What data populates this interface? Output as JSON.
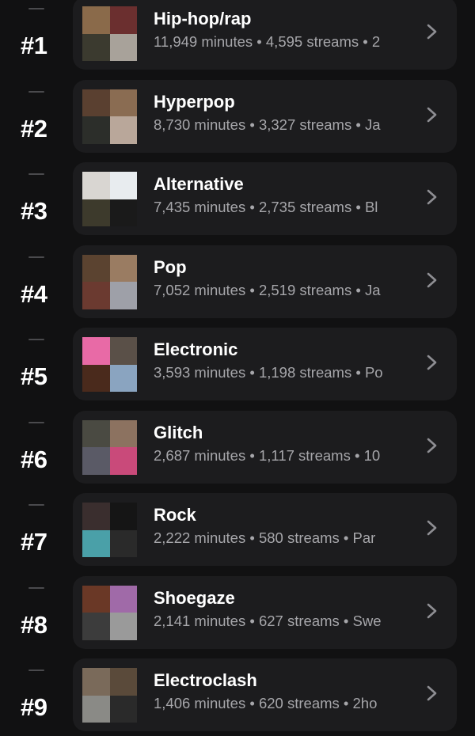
{
  "rows": [
    {
      "rank": "#1",
      "genre": "Hip-hop/rap",
      "meta": "11,949 minutes • 4,595 streams • 2",
      "art": [
        "#8a6a4a",
        "#6b2f2f",
        "#3b3a2f",
        "#a8a29a"
      ]
    },
    {
      "rank": "#2",
      "genre": "Hyperpop",
      "meta": "8,730 minutes • 3,327 streams • Ja",
      "art": [
        "#5a4030",
        "#8a6c52",
        "#2c2e2a",
        "#b9a79a"
      ]
    },
    {
      "rank": "#3",
      "genre": "Alternative",
      "meta": "7,435 minutes • 2,735 streams • Bl",
      "art": [
        "#d9d6d2",
        "#e8ecef",
        "#3d3a2c",
        "#1a1a1a"
      ]
    },
    {
      "rank": "#4",
      "genre": "Pop",
      "meta": "7,052 minutes • 2,519 streams • Ja",
      "art": [
        "#5b4330",
        "#9a7c62",
        "#6b3a30",
        "#9ea0a8"
      ]
    },
    {
      "rank": "#5",
      "genre": "Electronic",
      "meta": "3,593 minutes • 1,198 streams • Po",
      "art": [
        "#e86aa6",
        "#5a5048",
        "#4a2a1c",
        "#8aa4c0"
      ]
    },
    {
      "rank": "#6",
      "genre": "Glitch",
      "meta": "2,687 minutes • 1,117 streams • 10",
      "art": [
        "#4a4a42",
        "#8c7260",
        "#5a5a66",
        "#c94a7a"
      ]
    },
    {
      "rank": "#7",
      "genre": "Rock",
      "meta": "2,222 minutes • 580 streams • Par",
      "art": [
        "#3a2e2e",
        "#151515",
        "#4aa0a8",
        "#2a2a2a"
      ]
    },
    {
      "rank": "#8",
      "genre": "Shoegaze",
      "meta": "2,141 minutes • 627 streams • Swe",
      "art": [
        "#6a3826",
        "#a06aa8",
        "#3c3c3c",
        "#9a9a9a"
      ]
    },
    {
      "rank": "#9",
      "genre": "Electroclash",
      "meta": "1,406 minutes • 620 streams • 2ho",
      "art": [
        "#7a6a5a",
        "#5a4a3a",
        "#8a8a86",
        "#2a2a2a"
      ]
    }
  ],
  "icons": {
    "rank_change": "dash-icon",
    "open": "chevron-right-icon"
  },
  "colors": {
    "background": "#111112",
    "card": "#1c1c1e",
    "meta_text": "#a6a6aa",
    "chevron": "#8e8e93"
  }
}
